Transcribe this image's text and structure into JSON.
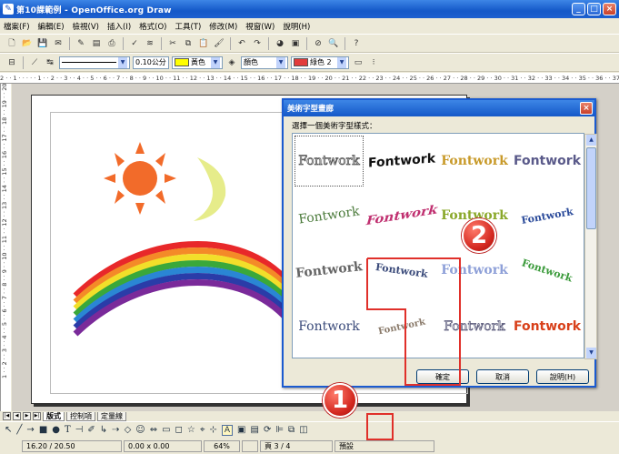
{
  "window": {
    "title": "第10課範例 - OpenOffice.org Draw"
  },
  "menu": [
    "檔案(F)",
    "編輯(E)",
    "檢視(V)",
    "插入(I)",
    "格式(O)",
    "工具(T)",
    "修改(M)",
    "視窗(W)",
    "說明(H)"
  ],
  "toolbar2": {
    "line_width": "0.10公分",
    "line_color": "黃色",
    "area_style": "顏色",
    "area_color": "綠色 2"
  },
  "rulers": {
    "horizontal": "2 · · 1 · · · · · 1 · · 2 · · 3 · · 4 · · 5 · · 6 · · 7 · · 8 · · 9 · · 10 · · 11 · · 12 · · 13 · · 14 · · 15 · · 16 · · 17 · · 18 · · 19 · · 20 · · 21 · · 22 · · 23 · · 24 · · 25 · · 26 · · 27 · · 28 · · 29 · · 30 · · 31 · · 32 · · 33 · · 34 · · 35 · · 36 · · 37 · · 38",
    "vertical": "1 · · 2 · · 3 · · 4 · · 5 · · 6 · · 7 · · 8 · · 9 · · 10 · · 11 · · 12 · · 13 · · 14 · · 15 · · 16 · · 17 · · 18 · · 19 · · 20"
  },
  "tabs": [
    "版式",
    "控制項",
    "定量線"
  ],
  "status": {
    "position": "16.20 / 20.50",
    "size": "0.00 x 0.00",
    "zoom": "64%",
    "page": "頁 3 / 4",
    "style": "預設"
  },
  "dialog": {
    "title": "美術字型畫廊",
    "label": "選擇一個美術字型樣式：",
    "items": [
      "Fontwork",
      "Fontwork",
      "Fontwork",
      "Fontwork",
      "Fontwork",
      "Fontwork",
      "Fontwork",
      "Fontwork",
      "Fontwork",
      "Fontwork",
      "Fontwork",
      "Fontwork",
      "Fontwork",
      "Fontwork",
      "Fontwork",
      "Fontwork"
    ],
    "ok": "確定",
    "cancel": "取消",
    "help": "說明(H)"
  },
  "callouts": {
    "first": "1",
    "second": "2"
  },
  "colors": {
    "title_bar": "#1458c8",
    "annotation_red": "#e0302a",
    "sun": "#f26b2a",
    "moon": "#e6ec8a"
  }
}
